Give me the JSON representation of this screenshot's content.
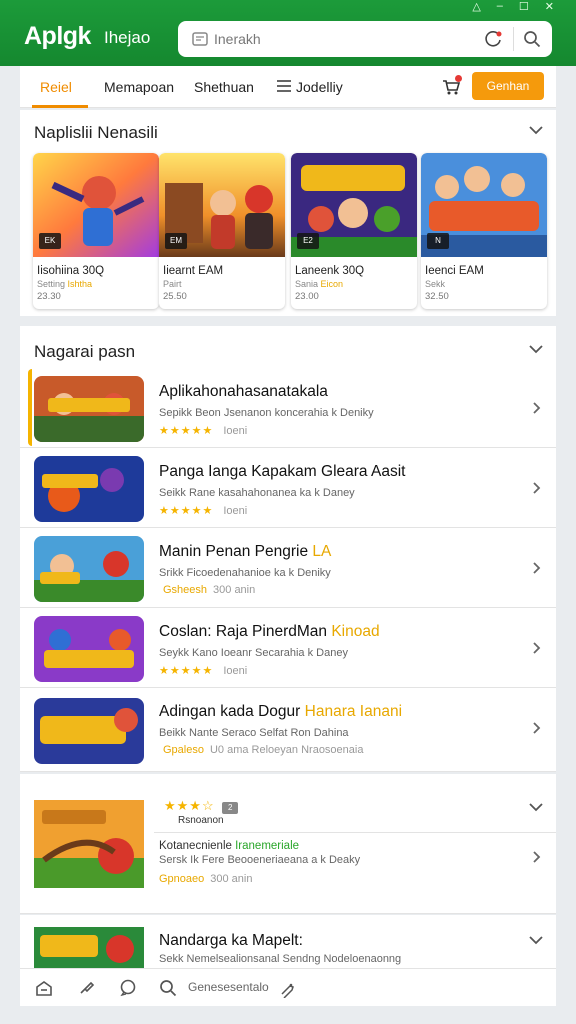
{
  "app": {
    "logo": "Aplgk",
    "subtitle": "Ihejao"
  },
  "window_controls": [
    "△",
    "–",
    "☐",
    "✕"
  ],
  "search": {
    "placeholder": "Inerakh"
  },
  "tabs": [
    {
      "label": "Reiel",
      "active": true
    },
    {
      "label": "Memapoan",
      "active": false
    },
    {
      "label": "Shethuan",
      "active": false
    },
    {
      "label": "Jodelliy",
      "active": false
    }
  ],
  "cta_label": "Genhan",
  "featured": {
    "title": "Naplislii Nenasili",
    "cards": [
      {
        "badge": "EK",
        "name": "Iisohiina 30Q",
        "sub": "Setting",
        "sub_hl": "Ishtha",
        "price": "23.30"
      },
      {
        "badge": "EM",
        "name": "Iiearnt EAM",
        "sub": "Pairt",
        "sub_hl": "",
        "price": "25.50"
      },
      {
        "badge": "E2",
        "name": "Laneenk 30Q",
        "sub": "Sania",
        "sub_hl": "Eicon",
        "price": "23.00"
      },
      {
        "badge": "N",
        "name": "Ieenci EAM",
        "sub": "Sekk",
        "sub_hl": "",
        "price": "32.50"
      }
    ]
  },
  "new_section": {
    "title": "Nagarai pasn",
    "rows": [
      {
        "title": "Aplikahonahasanatakala",
        "title_hl": "",
        "desc": "Sepikk Beon Jsenanon koncerahia k Deniky",
        "stars": "★★★★★",
        "rate_hl": "",
        "rate_text": "Ioeni"
      },
      {
        "title": "Panga Ianga Kapakam Gleara Aasit",
        "title_hl": "",
        "desc": "Seikk Rane kasahahonanea ka k Daney",
        "stars": "★★★★★",
        "rate_hl": "",
        "rate_text": "Ioeni"
      },
      {
        "title": "Manin Penan Pengrie",
        "title_hl": "LA",
        "desc": "Srikk Ficoedenahanioe ka k Deniky",
        "stars": "",
        "rate_hl": "Gsheesh",
        "rate_text": "300 anin"
      },
      {
        "title": "Coslan: Raja PinerdMan",
        "title_hl": "Kinoad",
        "desc": "Seykk Kano Ioeanr Secarahia k Daney",
        "stars": "★★★★★",
        "rate_hl": "",
        "rate_text": "Ioeni"
      },
      {
        "title": "Adingan kada Dogur",
        "title_hl": "Hanara Ianani",
        "desc": "Beikk Nante Seraco Selfat Ron Dahina",
        "stars": "",
        "rate_hl": "Gpaleso",
        "rate_text": "U0 ama  Reloeyan Nraosoenaia"
      }
    ],
    "expanded": {
      "stars": "★★★☆",
      "badge": "2",
      "count": "Rsnoanon",
      "title": "Kotanecnienle",
      "title_hl": "Iranemeriale",
      "desc": "Sersk Ik Fere Beooeneriaeana a k Deaky",
      "rate_hl": "Gpnoaeo",
      "rate_text": "300 anin"
    },
    "last_row": {
      "title": "Nandarga ka Mapelt:",
      "desc": "Sekk  Nemelsealionsanal  Sendng  Nodeloenaonng"
    }
  },
  "bottom_nav": {
    "search_text": "Genesesentalo"
  },
  "colors": {
    "header": "#1c9b3a",
    "accent": "#f08c00",
    "cta": "#f59a0c",
    "star": "#f5b400"
  }
}
